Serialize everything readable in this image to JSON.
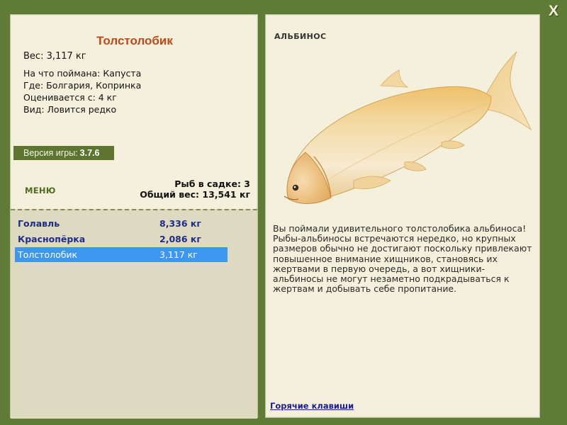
{
  "close": {
    "label": "X"
  },
  "left_panel": {
    "title": "Толстолобик",
    "weight_text": "Вес: 3,117 кг",
    "info_lines": [
      "На что поймана: Капуста",
      "Где: Болгария, Копринка",
      "Оценивается с: 4 кг",
      "Вид: Ловится редко"
    ],
    "version": {
      "label": "Версия игры:",
      "value": "3.7.6"
    },
    "menu_label": "МЕНЮ",
    "cage": {
      "count_text": "Рыб в садке: 3",
      "total_text": "Общий вес: 13,541 кг"
    },
    "fish_list": [
      {
        "name": "Голавль",
        "weight": "8,336 кг",
        "selected": false
      },
      {
        "name": "Краснопёрка",
        "weight": "2,086 кг",
        "selected": false
      },
      {
        "name": "Толстолобик",
        "weight": "3,117 кг",
        "selected": true
      }
    ]
  },
  "right_panel": {
    "label": "АЛЬБИНОС",
    "fish_image_icon": "albino-silver-carp-image",
    "description": "Вы поймали удивительного толстолобика альбиноса! Рыбы-альбиносы встречаются нередко, но крупных размеров обычно не достигают поскольку привлекают повышенное внимание хищников, становясь их жертвами в первую очередь, а вот хищники-альбиносы не могут незаметно подкрадываться к жертвам и добывать себе пропитание.",
    "hotkeys_link": "Горячие клавиши"
  },
  "colors": {
    "background": "#5f7b36",
    "panel": "#f4f0dc",
    "title": "#c0491b",
    "list_area": "#dedac1",
    "list_text": "#1e2d8a",
    "selected_row": "#3e97ef",
    "version_bar": "#5e7532"
  }
}
